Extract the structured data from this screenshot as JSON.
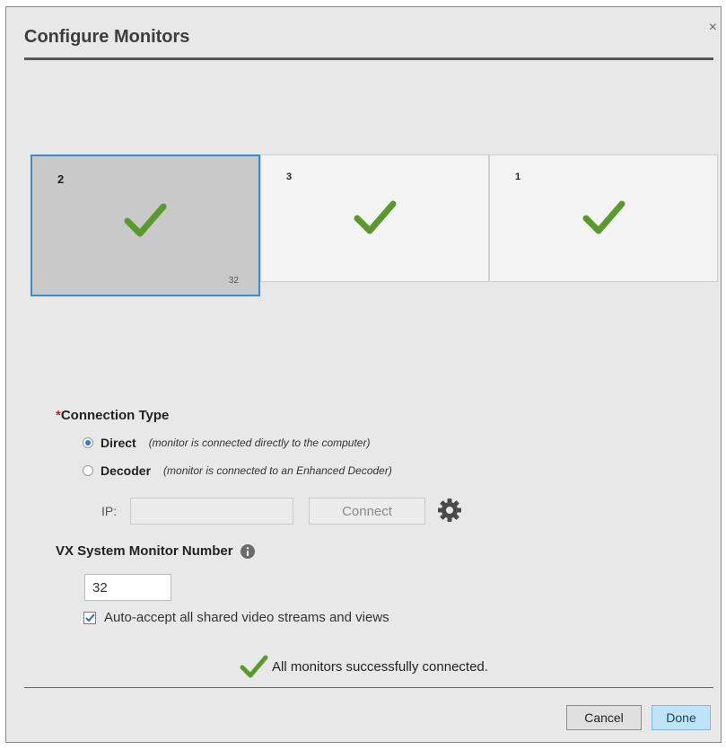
{
  "dialog": {
    "title": "Configure Monitors",
    "close_glyph": "×"
  },
  "monitors": [
    {
      "number": "2",
      "selected": true,
      "vx_number": "32",
      "status_icon": "check-icon"
    },
    {
      "number": "3",
      "selected": false,
      "status_icon": "check-icon"
    },
    {
      "number": "1",
      "selected": false,
      "status_icon": "check-icon"
    }
  ],
  "connection": {
    "required_mark": "*",
    "label": "Connection Type",
    "options": [
      {
        "label": "Direct",
        "hint": "(monitor is connected directly to the computer)",
        "selected": true
      },
      {
        "label": "Decoder",
        "hint": "(monitor is connected to an Enhanced Decoder)",
        "selected": false
      }
    ],
    "ip_label": "IP:",
    "ip_value": "",
    "connect_label": "Connect"
  },
  "vx": {
    "label": "VX System Monitor Number",
    "value": "32",
    "auto_accept_label": "Auto-accept all shared video streams and views",
    "auto_accept_checked": true
  },
  "status": {
    "message": "All monitors successfully connected."
  },
  "footer": {
    "cancel_label": "Cancel",
    "done_label": "Done"
  },
  "colors": {
    "check_green": "#5a9a2d",
    "selected_border": "#3b8ccf",
    "radio_dot": "#2f7fce",
    "done_bg": "#bfe3f7"
  }
}
